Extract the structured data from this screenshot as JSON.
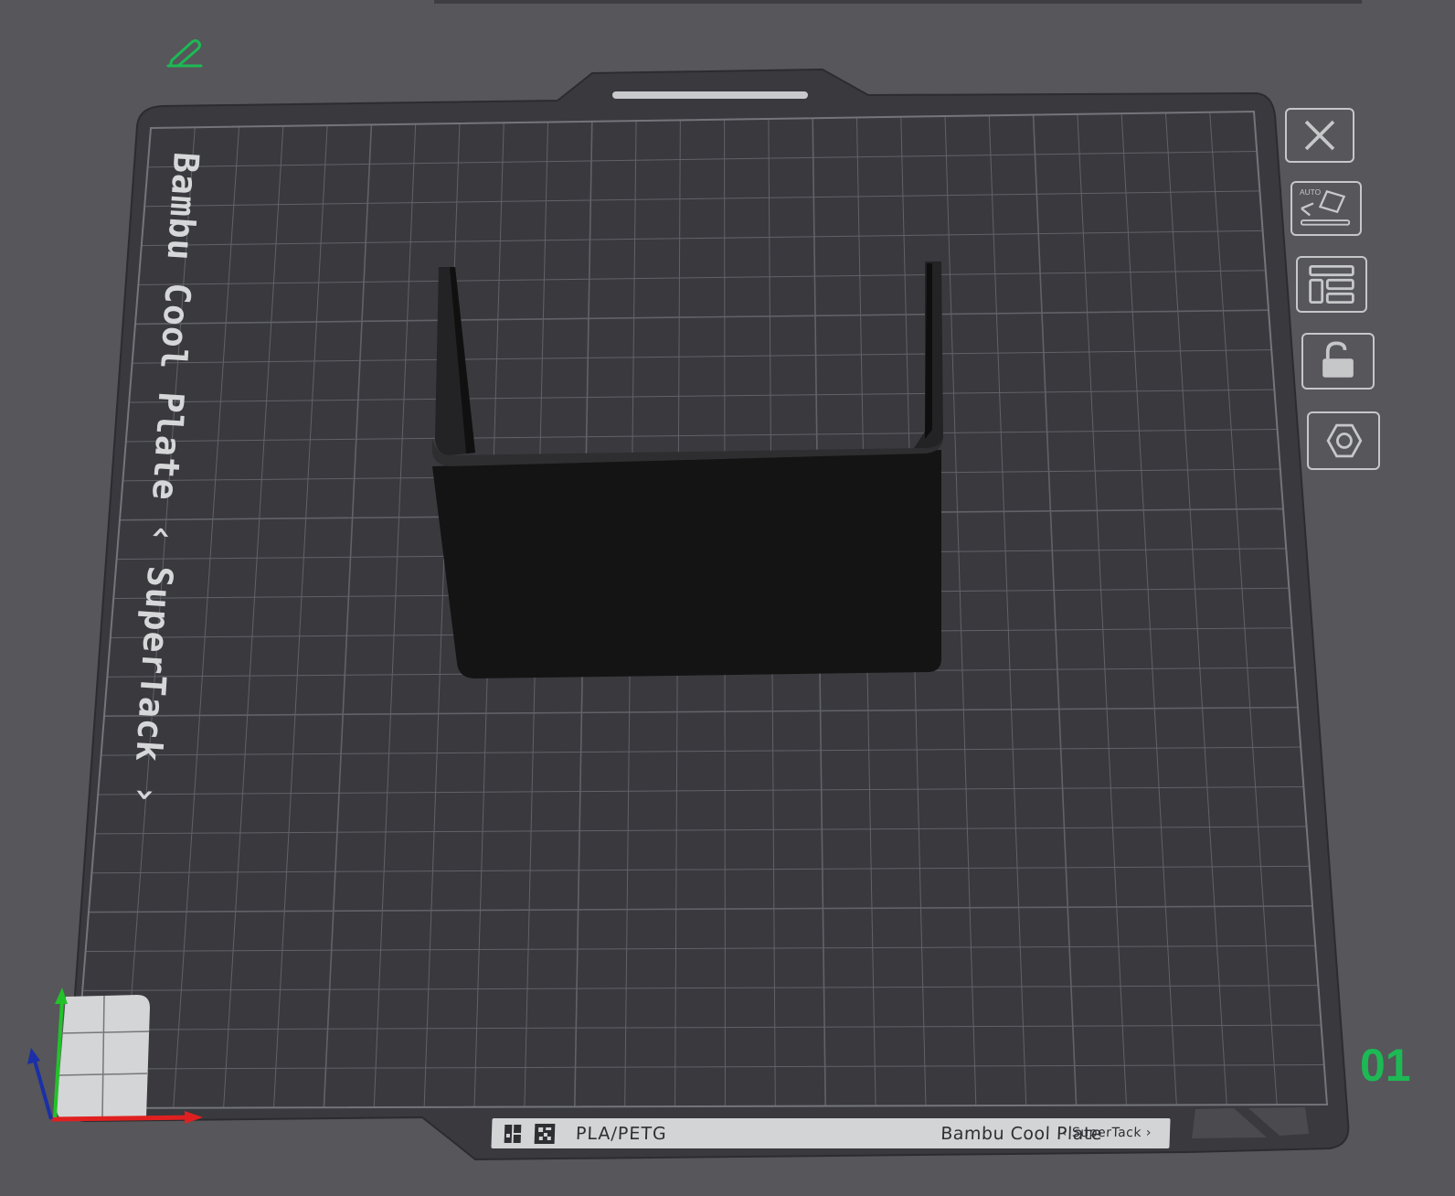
{
  "plate": {
    "side_label": "Bambu Cool Plate ‹ SuperTack ›",
    "number": "01",
    "material": "PLA/PETG",
    "name": "Bambu Cool Plate",
    "name_sub": "‹ SuperTack ›"
  },
  "toolbar": {
    "auto_label": "AUTO"
  },
  "icons": {
    "edit": "pencil-icon",
    "close": "close-icon",
    "auto_orient": "auto-orient-icon",
    "arrange": "arrange-icon",
    "lock": "lock-icon",
    "settings": "hexagon-icon"
  },
  "colors": {
    "background": "#56565b",
    "plate": "#39393e",
    "grid": "#6c6d73",
    "model": "#141414",
    "accent": "#1db954",
    "axis_x": "#e02020",
    "axis_y": "#22c22a",
    "axis_z": "#1a2fa8"
  }
}
